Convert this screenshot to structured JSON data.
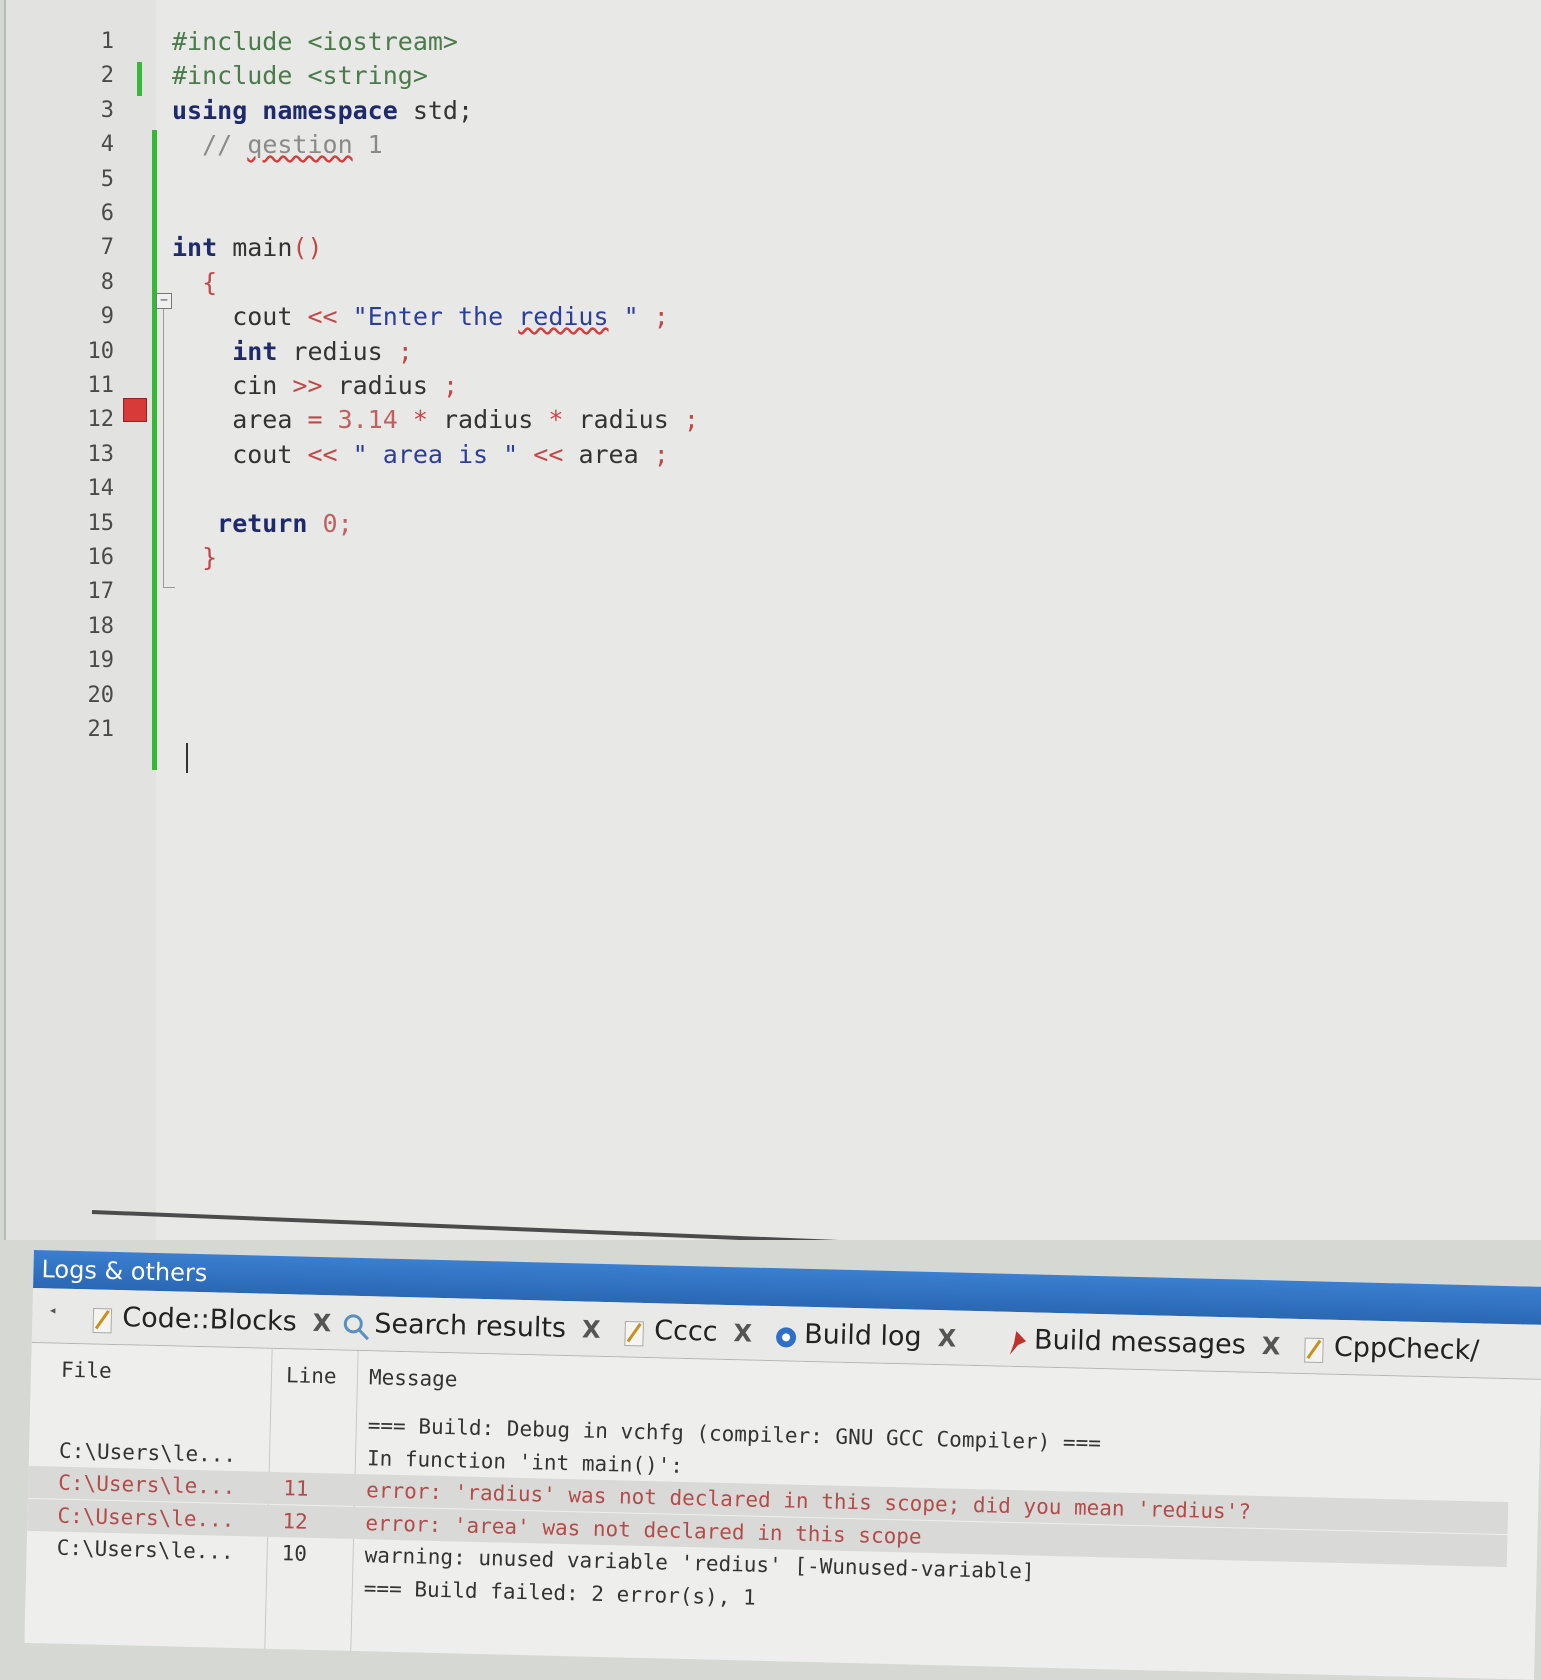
{
  "editor": {
    "lines": [
      {
        "n": "1",
        "html": "<span class=\"pp\">#include &lt;iostream&gt;</span>"
      },
      {
        "n": "2",
        "html": "<span class=\"pp\">#include &lt;string&gt;</span>"
      },
      {
        "n": "3",
        "html": "<span class=\"kw\">using namespace</span> std;"
      },
      {
        "n": "4",
        "html": "  <span class=\"cmt\">// <span class=\"squig\">qestion</span> 1</span>"
      },
      {
        "n": "5",
        "html": ""
      },
      {
        "n": "6",
        "html": ""
      },
      {
        "n": "7",
        "html": "<span class=\"kw\">int</span> main<span class=\"op\">()</span>"
      },
      {
        "n": "8",
        "html": "  <span class=\"op\">{</span>"
      },
      {
        "n": "9",
        "html": "    cout <span class=\"op\">&lt;&lt;</span> <span class=\"str\">\"Enter the <span class=\"squig\">redius</span> \"</span> <span class=\"op\">;</span>"
      },
      {
        "n": "10",
        "html": "    <span class=\"kw\">int</span> redius <span class=\"op\">;</span>"
      },
      {
        "n": "11",
        "html": "    cin <span class=\"op\">&gt;&gt;</span> radius <span class=\"op\">;</span>"
      },
      {
        "n": "12",
        "html": "    area <span class=\"op\">=</span> <span class=\"num\">3.14</span> <span class=\"op\">*</span> radius <span class=\"op\">*</span> radius <span class=\"op\">;</span>"
      },
      {
        "n": "13",
        "html": "    cout <span class=\"op\">&lt;&lt;</span> <span class=\"str\">\" area is \"</span> <span class=\"op\">&lt;&lt;</span> area <span class=\"op\">;</span>"
      },
      {
        "n": "14",
        "html": ""
      },
      {
        "n": "15",
        "html": "   <span class=\"kw\">return</span> <span class=\"num\">0;</span>"
      },
      {
        "n": "16",
        "html": "  <span class=\"op\">}</span>"
      },
      {
        "n": "17",
        "html": ""
      },
      {
        "n": "18",
        "html": ""
      },
      {
        "n": "19",
        "html": ""
      },
      {
        "n": "20",
        "html": ""
      },
      {
        "n": "21",
        "html": ""
      }
    ]
  },
  "logs": {
    "title": "Logs & others",
    "tabs": [
      {
        "label": "Code::Blocks",
        "icon": "pencil-icon",
        "close": "X"
      },
      {
        "label": "Search results",
        "icon": "magnifier-icon",
        "close": "X"
      },
      {
        "label": "Cccc",
        "icon": "pencil-icon",
        "close": "X"
      },
      {
        "label": "Build log",
        "icon": "gear-icon",
        "close": "X"
      },
      {
        "label": "Build messages",
        "icon": "pin-icon",
        "close": "X"
      },
      {
        "label": "CppCheck/",
        "icon": "pencil-icon",
        "close": ""
      }
    ],
    "columns": {
      "file": "File",
      "line": "Line",
      "message": "Message"
    },
    "rows": [
      {
        "file": "",
        "line": "",
        "message": "=== Build: Debug in vchfg (compiler: GNU GCC Compiler) ===",
        "type": "info"
      },
      {
        "file": "C:\\Users\\le...",
        "line": "",
        "message": "In function 'int main()':",
        "type": "info"
      },
      {
        "file": "C:\\Users\\le...",
        "line": "11",
        "message": "error: 'radius' was not declared in this scope; did you mean 'redius'?",
        "type": "error"
      },
      {
        "file": "C:\\Users\\le...",
        "line": "12",
        "message": "error: 'area' was not declared in this scope",
        "type": "error"
      },
      {
        "file": "C:\\Users\\le...",
        "line": "10",
        "message": "warning: unused variable 'redius' [-Wunused-variable]",
        "type": "info"
      },
      {
        "file": "",
        "line": "",
        "message": "=== Build failed: 2 error(s), 1",
        "type": "info"
      }
    ]
  },
  "colors": {
    "accent": "#2a67b4",
    "change_bar": "#38b838",
    "breakpoint": "#d83a3a",
    "error_text": "#b34b4b"
  }
}
